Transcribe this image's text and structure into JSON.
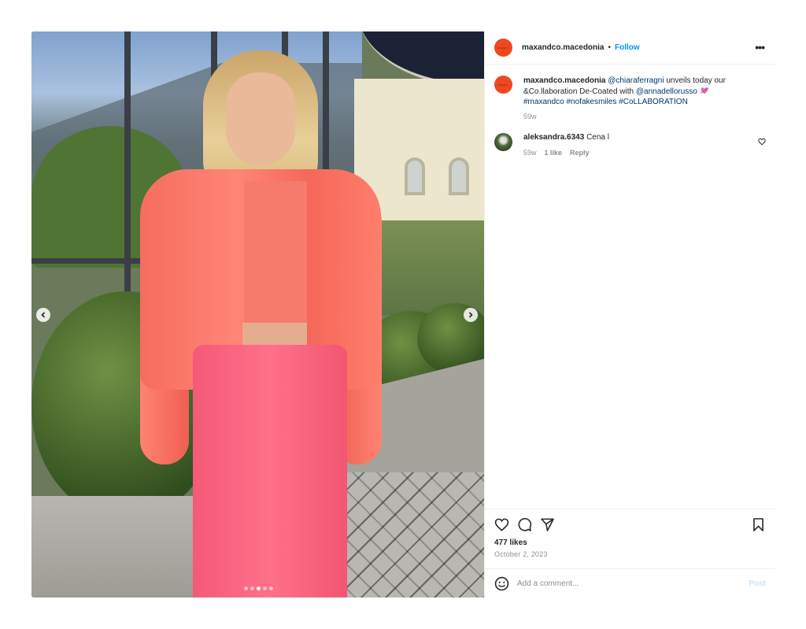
{
  "post": {
    "media": {
      "alt": "Woman in coral patent bomber jacket, crop top and pink trousers in front of a glass building",
      "carousel": {
        "count": 5,
        "active_index": 2
      },
      "prev_icon": "chevron-left-icon",
      "next_icon": "chevron-right-icon"
    },
    "header": {
      "avatar_text": "MAX&Co.",
      "username": "maxandco.macedonia",
      "separator": "•",
      "follow_label": "Follow",
      "more_icon": "more-horizontal-icon",
      "more_label": "•••"
    },
    "caption": {
      "username": "maxandco.macedonia",
      "mention_1": "@chiaraferragni",
      "text_1": " unveils today our &Co.llaboration De-Coated with ",
      "mention_2": "@annadellorusso",
      "emoji": "heart-with-arrow-emoji",
      "hashtags": [
        "#maxandco",
        "#nofakesmiles",
        "#CoLLABORATION"
      ],
      "time": "59w"
    },
    "comments": [
      {
        "username": "aleksandra.6343",
        "text": "Cena l",
        "time": "59w",
        "likes": "1 like",
        "reply_label": "Reply",
        "like_icon": "heart-outline-icon"
      }
    ],
    "actions": {
      "like_icon": "heart-outline-icon",
      "comment_icon": "comment-icon",
      "share_icon": "paper-plane-icon",
      "save_icon": "bookmark-icon",
      "likes_text": "477 likes",
      "date": "October 2, 2023"
    },
    "add_comment": {
      "emoji_icon": "smiley-icon",
      "placeholder": "Add a comment...",
      "post_label": "Post"
    }
  },
  "colors": {
    "follow": "#0095f6",
    "link": "#00376b",
    "muted": "#8e8e8e",
    "avatar": "#f0471f",
    "post_disabled": "#c7e6fd"
  }
}
